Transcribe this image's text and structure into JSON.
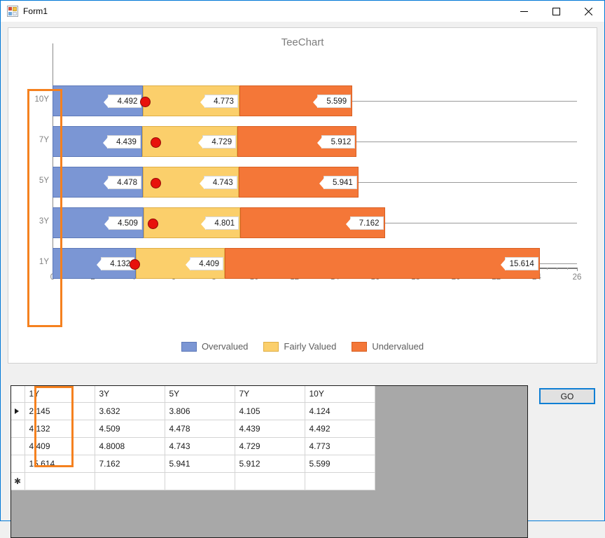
{
  "window": {
    "title": "Form1",
    "icon": "form-designer-icon",
    "controls": {
      "minimize": "minimize-icon",
      "maximize": "maximize-icon",
      "close": "close-icon"
    }
  },
  "chart": {
    "title": "TeeChart",
    "accent_annotation_color": "#f5811f"
  },
  "chart_data": {
    "type": "bar",
    "orientation": "horizontal",
    "stacked": true,
    "title": "TeeChart",
    "xlabel": "",
    "ylabel": "",
    "categories": [
      "10Y",
      "7Y",
      "5Y",
      "3Y",
      "1Y"
    ],
    "xlim": [
      0,
      26
    ],
    "xticks": [
      0,
      2,
      4,
      6,
      8,
      10,
      12,
      14,
      16,
      18,
      20,
      22,
      24,
      26
    ],
    "grid": false,
    "legend_position": "bottom",
    "series": [
      {
        "name": "Overvalued",
        "color": "#7b96d4",
        "values": [
          4.492,
          4.439,
          4.478,
          4.509,
          4.132
        ]
      },
      {
        "name": "Fairly Valued",
        "color": "#fbcf6b",
        "values": [
          4.773,
          4.729,
          4.743,
          4.801,
          4.409
        ]
      },
      {
        "name": "Undervalued",
        "color": "#f47738",
        "values": [
          5.599,
          5.912,
          5.941,
          7.162,
          15.614
        ]
      }
    ],
    "point_series": {
      "name": "marker",
      "color": "#e8120c",
      "values": [
        4.55,
        5.1,
        5.08,
        4.96,
        4.05
      ]
    },
    "totals": [
      14.864,
      15.08,
      15.162,
      16.472,
      24.155
    ]
  },
  "grid": {
    "columns": [
      "1Y",
      "3Y",
      "5Y",
      "7Y",
      "10Y"
    ],
    "rows": [
      [
        "2.145",
        "3.632",
        "3.806",
        "4.105",
        "4.124"
      ],
      [
        "4.132",
        "4.509",
        "4.478",
        "4.439",
        "4.492"
      ],
      [
        "4.409",
        "4.8008",
        "4.743",
        "4.729",
        "4.773"
      ],
      [
        "15.614",
        "7.162",
        "5.941",
        "5.912",
        "5.599"
      ],
      [
        "",
        "",
        "",
        "",
        ""
      ]
    ],
    "selected_row": 0,
    "selected_column": 0,
    "current_row_marker": "row-selector-arrow",
    "new_row_marker": "new-row-asterisk"
  },
  "buttons": {
    "go": "GO"
  }
}
